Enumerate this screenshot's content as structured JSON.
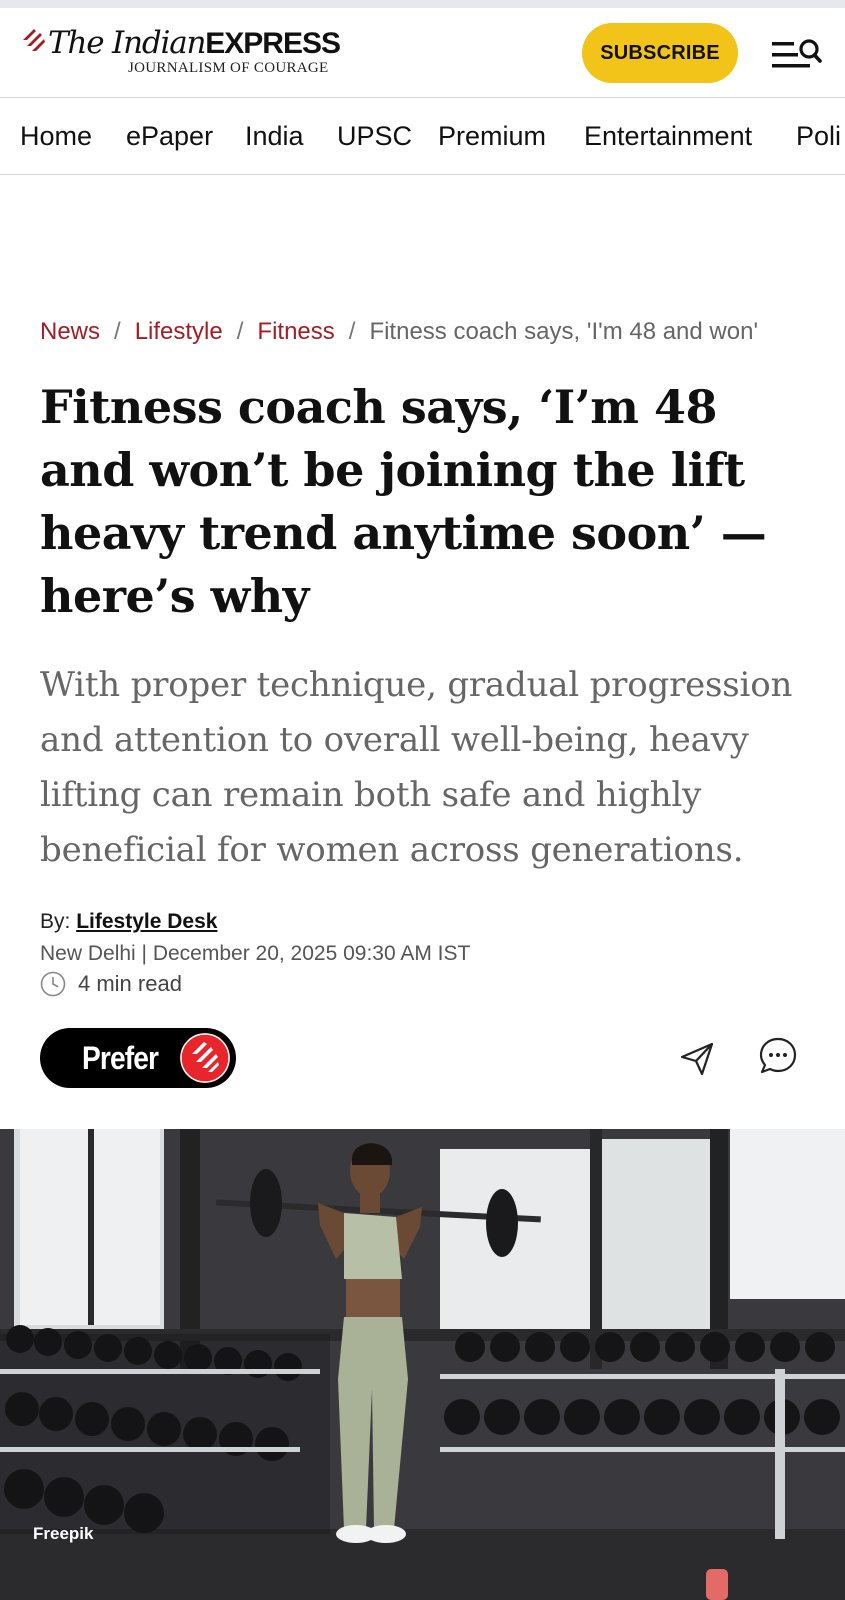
{
  "header": {
    "logo_title_italic": "The Indian",
    "logo_title_bold": "EXPRESS",
    "logo_tagline": "JOURNALISM OF COURAGE",
    "subscribe_label": "SUBSCRIBE",
    "brand_color": "#a41d24",
    "accent_yellow": "#f2c318",
    "menu_icon": "menu-search-icon"
  },
  "nav": {
    "items": [
      "Home",
      "ePaper",
      "India",
      "UPSC",
      "Premium",
      "Entertainment",
      "Poli"
    ]
  },
  "breadcrumb": {
    "items": [
      "News",
      "Lifestyle",
      "Fitness"
    ],
    "separator": "/",
    "current": "Fitness coach says, 'I'm 48 and won'"
  },
  "article": {
    "headline": "Fitness coach says, ‘I’m 48 and won’t be joining the lift heavy trend anytime soon’ — here’s why",
    "standfirst": "With proper technique, gradual progression and attention to overall well-being, heavy lifting can remain both safe and highly beneficial for women across generations.",
    "byline_prefix": "By:",
    "author": "Lifestyle Desk",
    "dateline": "New Delhi | December 20, 2025 09:30 AM IST",
    "read_time": "4 min read"
  },
  "actions": {
    "prefer_label": "Prefer",
    "share_icon": "send-icon",
    "comment_icon": "comment-icon"
  },
  "hero": {
    "credit": "Freepik"
  }
}
